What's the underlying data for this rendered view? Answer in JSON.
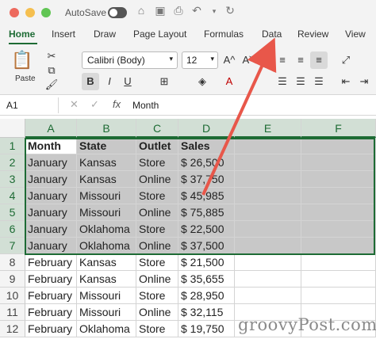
{
  "titlebar": {
    "autosave_label": "AutoSave",
    "traffic_lights": [
      "#ed6a5e",
      "#f5bf4f",
      "#61c554"
    ],
    "icons": [
      "home-icon",
      "save-icon",
      "print-icon",
      "undo-icon",
      "redo-icon",
      "refresh-icon"
    ]
  },
  "ribbon": {
    "tabs": [
      "Home",
      "Insert",
      "Draw",
      "Page Layout",
      "Formulas",
      "Data",
      "Review",
      "View"
    ],
    "active_tab": "Home",
    "font_name": "Calibri (Body)",
    "font_size": "12",
    "paste_label": "Paste",
    "bold_label": "B",
    "italic_label": "I",
    "underline_label": "U",
    "font_grow": "A^",
    "font_shrink": "Aˇ",
    "font_color_glyph": "A"
  },
  "formula_bar": {
    "name_box": "A1",
    "cancel": "✕",
    "confirm": "✓",
    "fx": "fx",
    "value": "Month"
  },
  "sheet": {
    "columns": [
      "A",
      "B",
      "C",
      "D",
      "E",
      "F"
    ],
    "rows": [
      "1",
      "2",
      "3",
      "4",
      "5",
      "6",
      "7",
      "8",
      "9",
      "10",
      "11",
      "12"
    ],
    "selected_rows": 7,
    "cells": [
      [
        "Month",
        "State",
        "Outlet",
        "Sales"
      ],
      [
        "January",
        "Kansas",
        "Store",
        "$ 26,500"
      ],
      [
        "January",
        "Kansas",
        "Online",
        "$ 37,750"
      ],
      [
        "January",
        "Missouri",
        "Store",
        "$ 45,985"
      ],
      [
        "January",
        "Missouri",
        "Online",
        "$ 75,885"
      ],
      [
        "January",
        "Oklahoma",
        "Store",
        "$ 22,500"
      ],
      [
        "January",
        "Oklahoma",
        "Online",
        "$ 37,500"
      ],
      [
        "February",
        "Kansas",
        "Store",
        "$ 21,500"
      ],
      [
        "February",
        "Kansas",
        "Online",
        "$ 35,655"
      ],
      [
        "February",
        "Missouri",
        "Store",
        "$ 28,950"
      ],
      [
        "February",
        "Missouri",
        "Online",
        "$ 32,115"
      ],
      [
        "February",
        "Oklahoma",
        "Store",
        "$ 19,750"
      ]
    ]
  },
  "annotation": {
    "arrow_color": "#e8574a",
    "points_to": "Data"
  },
  "watermark": "groovyPost.com"
}
